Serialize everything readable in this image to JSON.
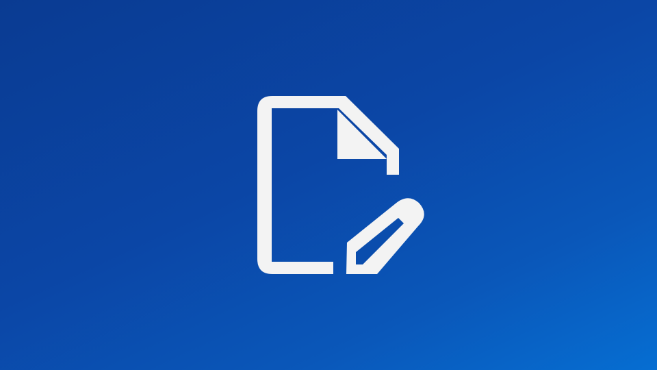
{
  "splash": {
    "icon": "document-edit-icon",
    "colors": {
      "background_dark": "#0a3b92",
      "background_mid": "#0b46a6",
      "background_light": "#066ed2",
      "icon": "#f3f3f3"
    }
  }
}
